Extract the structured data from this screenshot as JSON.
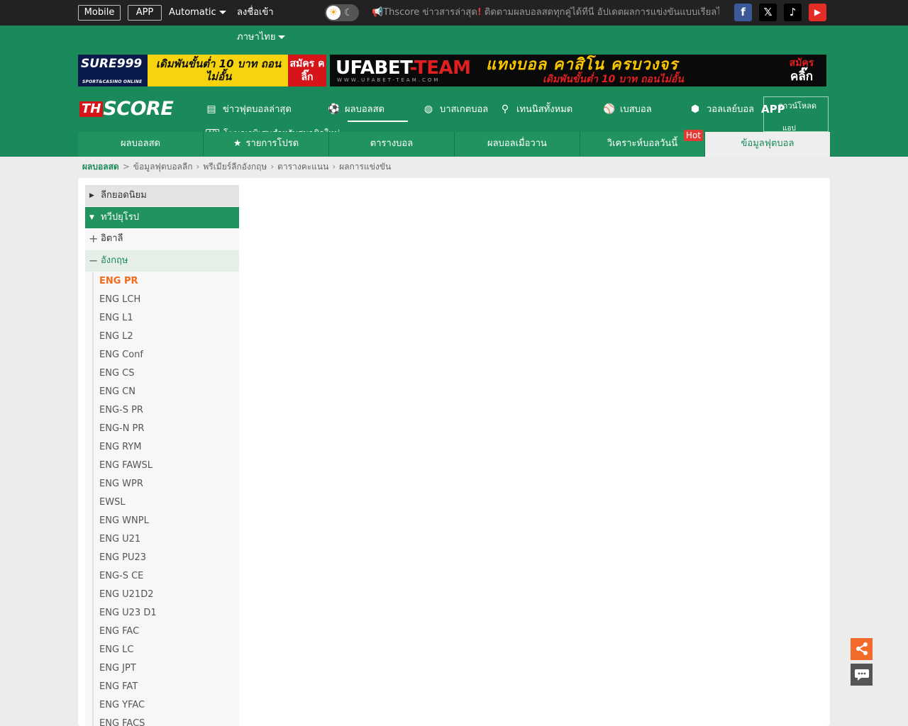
{
  "topbar": {
    "mobile_label": "Mobile",
    "app_label": "APP",
    "automatic_label": "Automatic",
    "login_label": "ลงชื่อเข้า",
    "theme_sun_icon": "☀",
    "theme_moon_icon": "☾",
    "marquee": {
      "icon": "📢",
      "prefix": "Thscore",
      "headline": "ข่าวสารล่าสุด",
      "exclaim": "!",
      "body": "ติดตามผลบอลสดทุกคู่ได้ที่นี่ อัปเดตผลการแข่งขันแบบเรียลไทม์ทุกวัน..."
    },
    "social": [
      {
        "name": "facebook",
        "glyph": "f",
        "color": "#3b5998"
      },
      {
        "name": "x",
        "glyph": "𝕏",
        "color": "#000000"
      },
      {
        "name": "tiktok",
        "glyph": "♪",
        "color": "#000000"
      },
      {
        "name": "youtube",
        "glyph": "▶",
        "color": "#e52d27"
      }
    ]
  },
  "language": {
    "selected": "ภาษาไทย"
  },
  "banners": {
    "left": {
      "logo": "SURE999",
      "logo_sub": "SPORT&CASINO ONLINE",
      "text": "เดิมพันขั้นต่ำ 10 บาท ถอนไม่อั้น",
      "cta": "สมัคร คลิ๊ก"
    },
    "right": {
      "logo_a": "UFABET",
      "logo_dash": "-",
      "logo_b": "TEAM",
      "url": "WWW.UFABET-TEAM.COM",
      "main": "แทงบอล คาสิโน ครบวงจร",
      "sub": "เดิมพันขั้นต่ำ 10 บาท ถอนไม่อั้น",
      "cta_top": "สมัคร",
      "cta_bottom": "คลิ๊ก"
    }
  },
  "logo": {
    "th": "TH",
    "score": "SCORE"
  },
  "nav": [
    {
      "label": "ข่าวฟุตบอลล่าสุด",
      "icon": "newspaper-icon",
      "glyph": "▤"
    },
    {
      "label": "ผลบอลสด",
      "icon": "soccer-ball-icon",
      "glyph": "⚽"
    },
    {
      "label": "บาสเกตบอล",
      "icon": "basketball-icon",
      "glyph": "◍"
    },
    {
      "label": "เทนนิสทั้งหมด",
      "icon": "tennis-icon",
      "glyph": "⚲"
    },
    {
      "label": "เบสบอล",
      "icon": "baseball-icon",
      "glyph": "⚾"
    },
    {
      "label": "วอลเลย์บอล",
      "icon": "volleyball-icon",
      "glyph": "⬢"
    }
  ],
  "app_box": {
    "big": "APP",
    "line1": "ดาวน์โหลด",
    "line2": "แอป"
  },
  "ad_line": {
    "badge": "AD",
    "text": "โฆษณาพิเศษสำหรับสมาชิกใหม่"
  },
  "subtabs": [
    {
      "label": "ผลบอลสด"
    },
    {
      "label": "รายการโปรด",
      "icon": "★"
    },
    {
      "label": "ตารางบอล"
    },
    {
      "label": "ผลบอลเมื่อวาน"
    },
    {
      "label": "วิเคราะห์บอลวันนี้",
      "badge": "Hot"
    },
    {
      "label": "ข้อมูลฟุตบอล"
    }
  ],
  "breadcrumb": {
    "home": "ผลบอลสด",
    "sep1": ">",
    "item1": "ข้อมูลฟุตบอลลีก",
    "item2": "พรีเมียร์ลีกอังกฤษ",
    "item3": "ตารางคะแนน",
    "item4": "ผลการแข่งขัน"
  },
  "sidebar": {
    "cat_closed": "ลีกยอดนิยม",
    "cat_open": "ทวีปยุโรป",
    "group_closed": "อิตาลี",
    "group_open": "อังกฤษ",
    "leagues": [
      "ENG PR",
      "ENG LCH",
      "ENG L1",
      "ENG L2",
      "ENG Conf",
      "ENG CS",
      "ENG CN",
      "ENG-S PR",
      "ENG-N PR",
      "ENG RYM",
      "ENG FAWSL",
      "ENG WPR",
      "EWSL",
      "ENG WNPL",
      "ENG U21",
      "ENG PU23",
      "ENG-S CE",
      "ENG U21D2",
      "ENG U23 D1",
      "ENG FAC",
      "ENG LC",
      "ENG JPT",
      "ENG FAT",
      "ENG YFAC",
      "ENG FACS"
    ],
    "active_league": "ENG PR"
  },
  "float_buttons": {
    "share_icon": "share-icon",
    "share_glyph": "⋖",
    "chat_icon": "chat-icon",
    "chat_glyph": "💬"
  }
}
